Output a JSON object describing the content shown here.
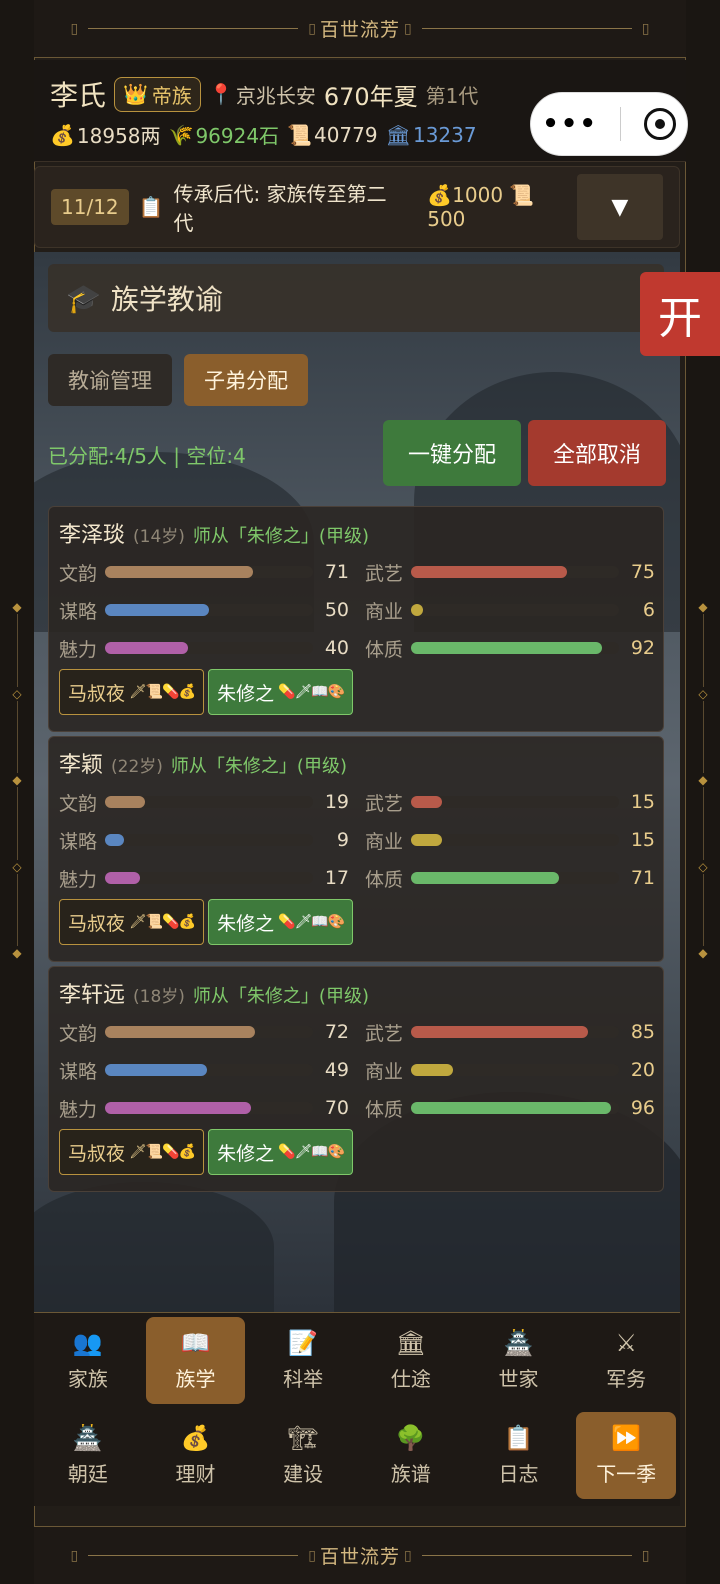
{
  "banner_title": "百世流芳",
  "header": {
    "surname": "李氏",
    "rank": "帝族",
    "location": "京兆长安",
    "year": "670年夏",
    "generation": "第1代",
    "resources": [
      {
        "icon": "money-bag-icon",
        "glyph": "💰",
        "value": "18958两",
        "tone": "white"
      },
      {
        "icon": "grain-icon",
        "glyph": "🌾",
        "value": "96924石",
        "tone": "green"
      },
      {
        "icon": "scroll-icon",
        "glyph": "📜",
        "value": "40779",
        "tone": "white"
      },
      {
        "icon": "bank-icon",
        "glyph": "🏛",
        "value": "13237",
        "tone": "blue"
      }
    ]
  },
  "quest": {
    "count": "11/12",
    "text": "传承后代: 家族传至第二代",
    "reward_money": "1000",
    "reward_scroll": "500",
    "toggle": "▼"
  },
  "section": {
    "title": "族学教谕",
    "open_btn": "开",
    "tabs": [
      "教谕管理",
      "子弟分配"
    ],
    "assign_status": "已分配:4/5人 | 空位:4",
    "btn_auto": "一键分配",
    "btn_cancel": "全部取消"
  },
  "students": [
    {
      "name": "李泽琰",
      "age": "(14岁)",
      "teacher": "师从「朱修之」(甲级)",
      "stats": [
        {
          "label": "文韵",
          "value": 71,
          "color": "#a8825e"
        },
        {
          "label": "武艺",
          "value": 75,
          "color": "#b85a4a"
        },
        {
          "label": "谋略",
          "value": 50,
          "color": "#5a86c0"
        },
        {
          "label": "商业",
          "value": 6,
          "color": "#c0a83e"
        },
        {
          "label": "魅力",
          "value": 40,
          "color": "#b060a8"
        },
        {
          "label": "体质",
          "value": 92,
          "color": "#6ab86a"
        }
      ],
      "tag1": "马叔夜",
      "tag1_icons": "🗡📜💊💰",
      "tag2": "朱修之",
      "tag2_icons": "💊🗡📖🎨"
    },
    {
      "name": "李颖",
      "age": "(22岁)",
      "teacher": "师从「朱修之」(甲级)",
      "stats": [
        {
          "label": "文韵",
          "value": 19,
          "color": "#a8825e"
        },
        {
          "label": "武艺",
          "value": 15,
          "color": "#b85a4a"
        },
        {
          "label": "谋略",
          "value": 9,
          "color": "#5a86c0"
        },
        {
          "label": "商业",
          "value": 15,
          "color": "#c0a83e"
        },
        {
          "label": "魅力",
          "value": 17,
          "color": "#b060a8"
        },
        {
          "label": "体质",
          "value": 71,
          "color": "#6ab86a"
        }
      ],
      "tag1": "马叔夜",
      "tag1_icons": "🗡📜💊💰",
      "tag2": "朱修之",
      "tag2_icons": "💊🗡📖🎨"
    },
    {
      "name": "李轩远",
      "age": "(18岁)",
      "teacher": "师从「朱修之」(甲级)",
      "stats": [
        {
          "label": "文韵",
          "value": 72,
          "color": "#a8825e"
        },
        {
          "label": "武艺",
          "value": 85,
          "color": "#b85a4a"
        },
        {
          "label": "谋略",
          "value": 49,
          "color": "#5a86c0"
        },
        {
          "label": "商业",
          "value": 20,
          "color": "#c0a83e"
        },
        {
          "label": "魅力",
          "value": 70,
          "color": "#b060a8"
        },
        {
          "label": "体质",
          "value": 96,
          "color": "#6ab86a"
        }
      ],
      "tag1": "马叔夜",
      "tag1_icons": "🗡📜💊💰",
      "tag2": "朱修之",
      "tag2_icons": "💊🗡📖🎨"
    }
  ],
  "nav": {
    "row1": [
      {
        "label": "家族",
        "glyph": "👥",
        "icon": "family-icon",
        "name": "family"
      },
      {
        "label": "族学",
        "glyph": "📖",
        "icon": "book-icon",
        "name": "clan-school",
        "active": true
      },
      {
        "label": "科举",
        "glyph": "📝",
        "icon": "exam-icon",
        "name": "exam"
      },
      {
        "label": "仕途",
        "glyph": "🏛",
        "icon": "official-icon",
        "name": "career"
      },
      {
        "label": "世家",
        "glyph": "🏯",
        "icon": "castle-icon",
        "name": "noble"
      },
      {
        "label": "军务",
        "glyph": "⚔",
        "icon": "swords-icon",
        "name": "military"
      }
    ],
    "row2": [
      {
        "label": "朝廷",
        "glyph": "🏯",
        "icon": "court-icon",
        "name": "court"
      },
      {
        "label": "理财",
        "glyph": "💰",
        "icon": "money-bag-icon",
        "name": "finance"
      },
      {
        "label": "建设",
        "glyph": "🏗",
        "icon": "crane-icon",
        "name": "build"
      },
      {
        "label": "族谱",
        "glyph": "🌳",
        "icon": "tree-icon",
        "name": "genealogy"
      },
      {
        "label": "日志",
        "glyph": "📋",
        "icon": "clipboard-icon",
        "name": "log"
      },
      {
        "label": "下一季",
        "glyph": "⏩",
        "icon": "fast-forward-icon",
        "name": "next-season",
        "active": true
      }
    ]
  }
}
